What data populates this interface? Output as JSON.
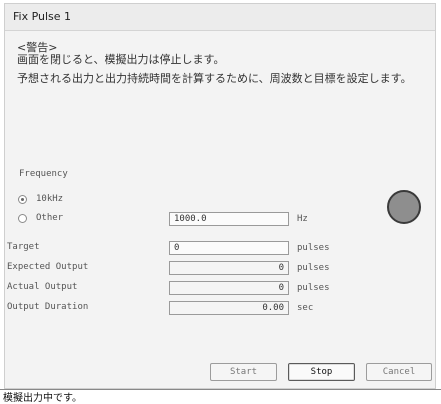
{
  "window": {
    "title": "Fix Pulse 1"
  },
  "warning": {
    "heading": "<警告>",
    "line1": "画面を閉じると、模擬出力は停止します。",
    "line2": "予想される出力と出力持続時間を計算するために、周波数と目標を設定します。"
  },
  "frequency": {
    "label": "Frequency",
    "options": [
      {
        "label": "10kHz",
        "selected": true
      },
      {
        "label": "Other",
        "selected": false
      }
    ],
    "other_value": "1000.0",
    "other_unit": "Hz"
  },
  "fields": {
    "target": {
      "label": "Target",
      "value": "0",
      "unit": "pulses"
    },
    "expected": {
      "label": "Expected Output",
      "value": "0",
      "unit": "pulses"
    },
    "actual": {
      "label": "Actual Output",
      "value": "0",
      "unit": "pulses"
    },
    "duration": {
      "label": "Output Duration",
      "value": "0.00",
      "unit": "sec"
    }
  },
  "indicator": {
    "color": "#8e8e8e"
  },
  "buttons": {
    "start": "Start",
    "stop": "Stop",
    "cancel": "Cancel"
  },
  "status": {
    "text": "模擬出力中です。"
  }
}
